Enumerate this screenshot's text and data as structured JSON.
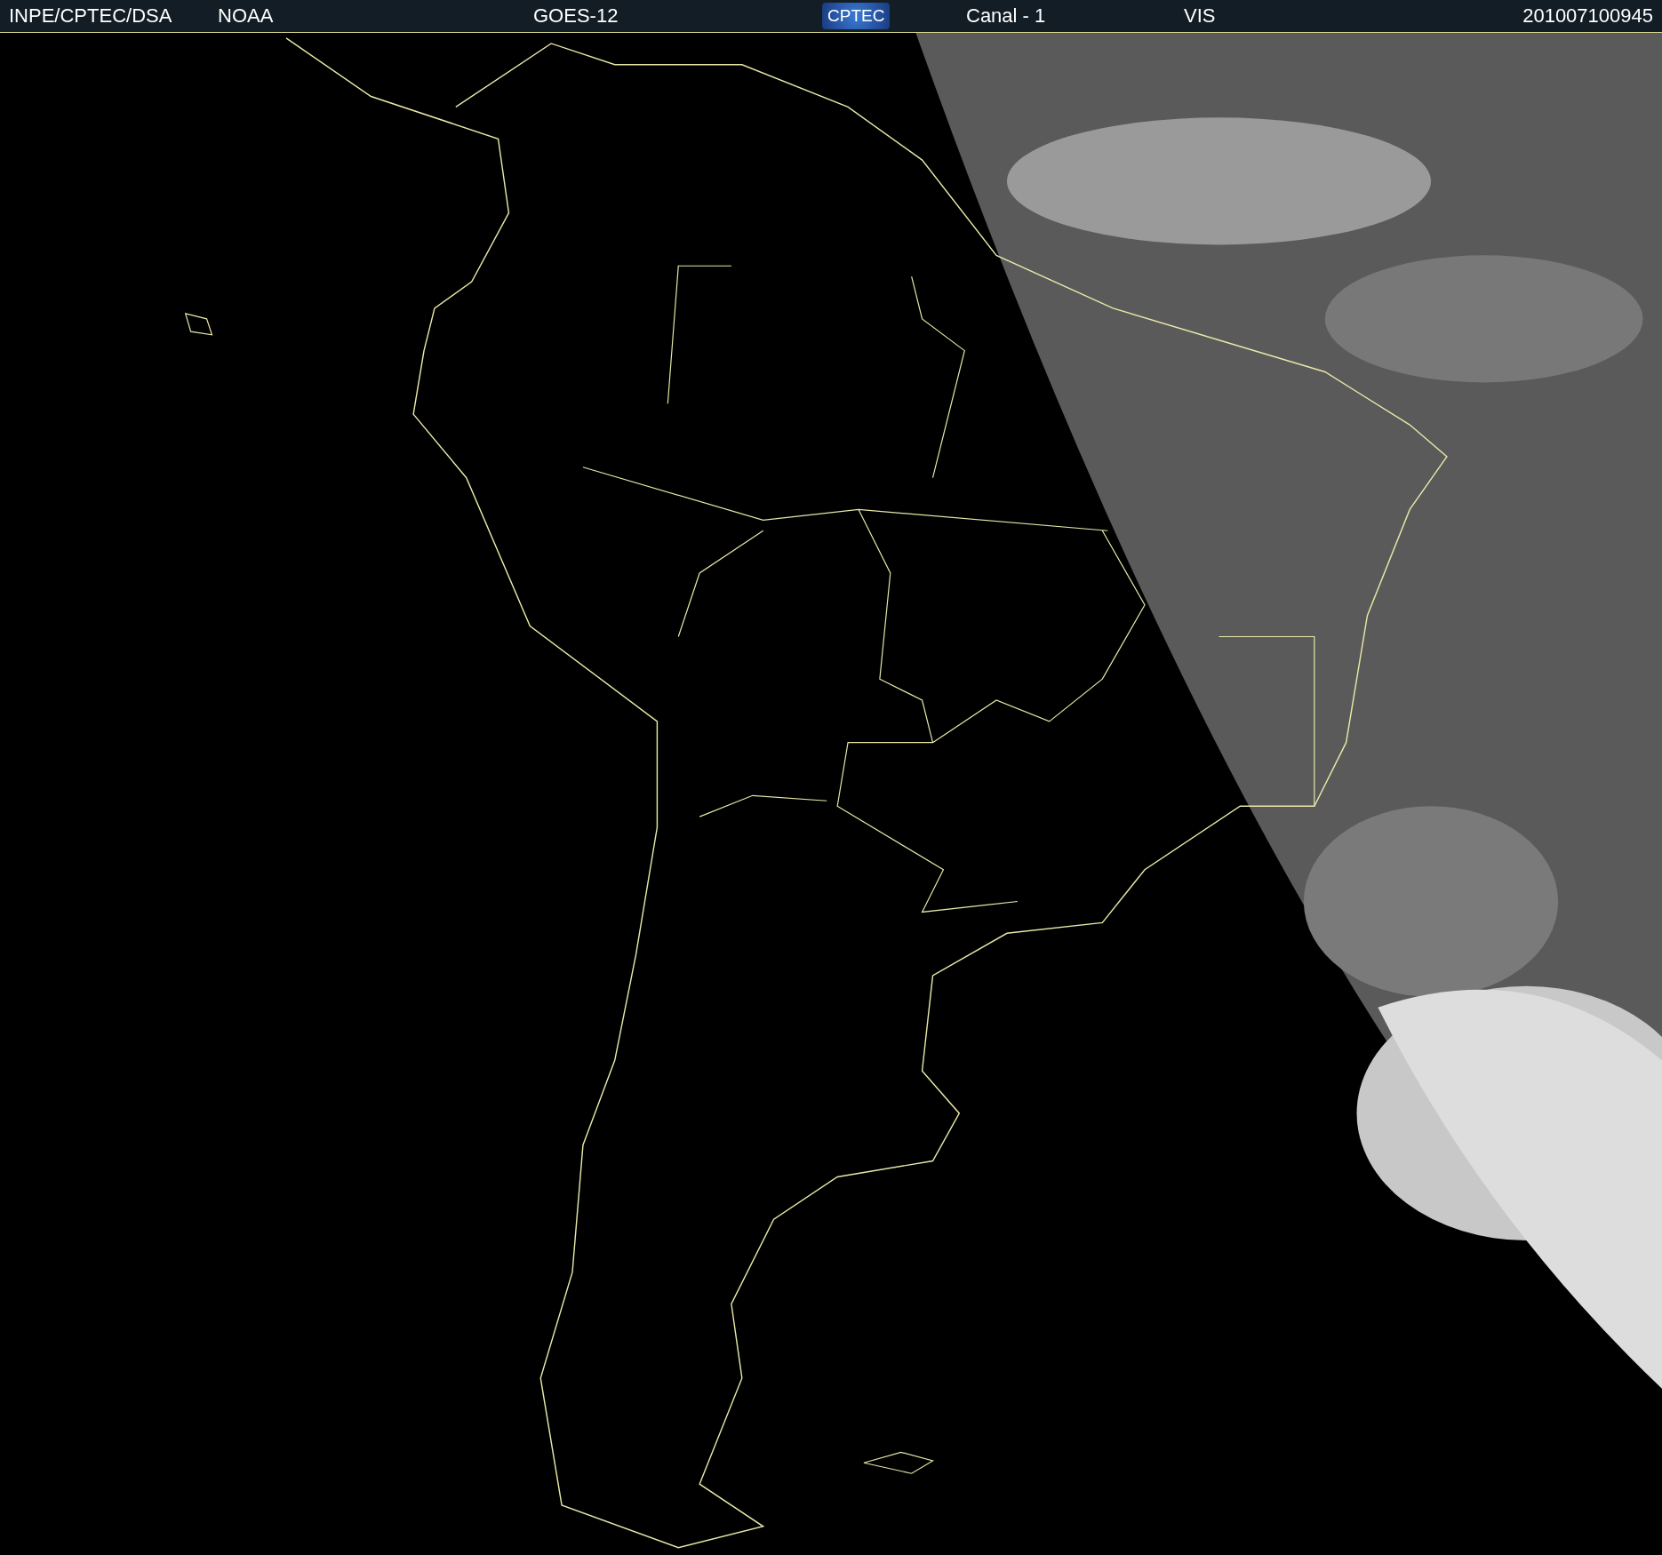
{
  "header": {
    "items": [
      {
        "text": "INPE/CPTEC/DSA"
      },
      {
        "text": "NOAA"
      },
      {
        "text": "GOES-12"
      },
      {
        "text": "CPTEC",
        "kind": "logo"
      },
      {
        "text": "Canal - 1"
      },
      {
        "text": "VIS"
      },
      {
        "text": "201007100945"
      }
    ]
  }
}
